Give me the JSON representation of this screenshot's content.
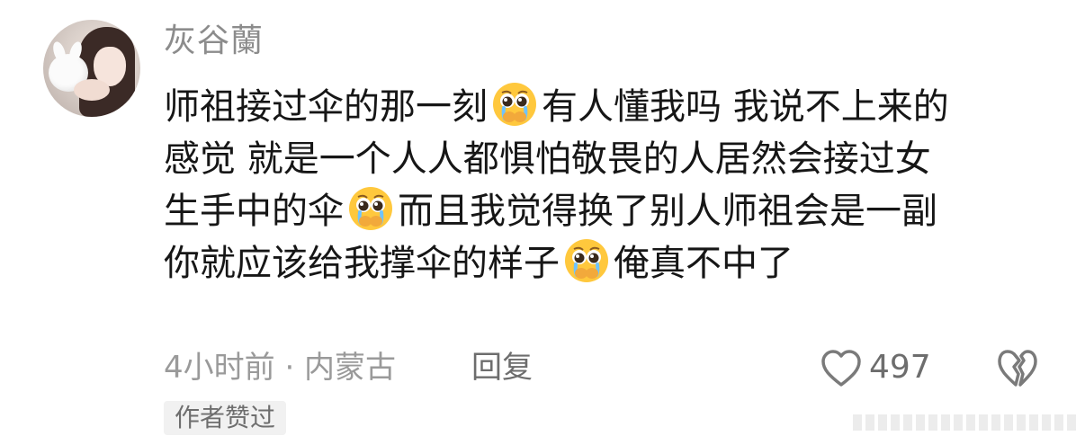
{
  "user": {
    "name": "灰谷蘭"
  },
  "comment": {
    "line1_a": "师祖接过伞的那一刻",
    "line1_b": "有人懂我吗 我说不上来的",
    "line2": "感觉 就是一个人人都惧怕敬畏的人居然会接过女",
    "line3_a": "生手中的伞",
    "line3_b": "而且我觉得换了别人师祖会是一副",
    "line4_a": "你就应该给我撑伞的样子",
    "line4_b": "俺真不中了"
  },
  "emoji_name": "pleading-face-icon",
  "meta": {
    "time_location": "4小时前 · 内蒙古",
    "reply_label": "回复"
  },
  "likes": {
    "count": "497"
  },
  "badge": {
    "author_liked": "作者赞过"
  },
  "colors": {
    "username": "#8c8c8c",
    "text": "#161616",
    "meta": "#9a9a9a",
    "badge_bg": "#f1f1f1"
  }
}
